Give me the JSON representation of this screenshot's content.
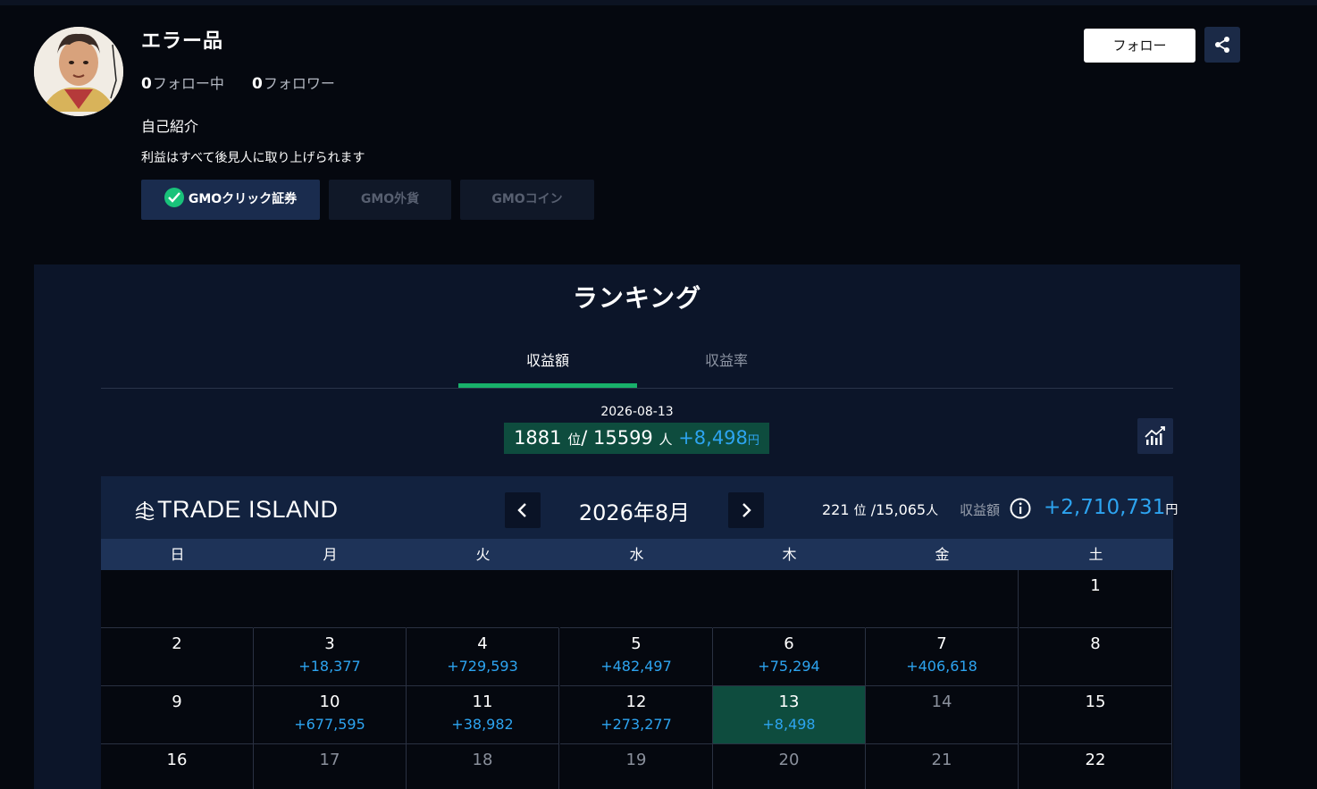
{
  "profile": {
    "name": "エラー品",
    "following_count": "0",
    "following_label": "フォロー中",
    "followers_count": "0",
    "followers_label": "フォロワー",
    "intro_heading": "自己紹介",
    "intro_text": "利益はすべて後見人に取り上げられます",
    "brokers": [
      {
        "label": "GMOクリック証券",
        "active": true
      },
      {
        "label": "GMO外貨",
        "active": false
      },
      {
        "label": "GMOコイン",
        "active": false
      }
    ],
    "follow_button": "フォロー",
    "share_icon": "share-icon"
  },
  "ranking": {
    "title": "ランキング",
    "tabs": [
      {
        "label": "収益額",
        "active": true
      },
      {
        "label": "収益率",
        "active": false
      }
    ],
    "daily": {
      "date": "2026-08-13",
      "rank": "1881",
      "rank_unit": "位",
      "separator": "/",
      "total": "15599",
      "total_unit": "人",
      "profit": "+8,498",
      "profit_unit": "円"
    },
    "chart_icon": "bar-chart-icon"
  },
  "calendar": {
    "brand": "TRADE ISLAND",
    "month": "2026年8月",
    "monthly_rank": "221",
    "monthly_rank_unit": "位",
    "monthly_total": "/15,065",
    "monthly_total_unit": "人",
    "monthly_label": "収益額",
    "monthly_profit": "+2,710,731",
    "monthly_profit_unit": "円",
    "weekdays": [
      "日",
      "月",
      "火",
      "水",
      "木",
      "金",
      "土"
    ],
    "weeks": [
      [
        null,
        null,
        null,
        null,
        null,
        null,
        {
          "day": "1",
          "profit": ""
        }
      ],
      [
        {
          "day": "2",
          "profit": ""
        },
        {
          "day": "3",
          "profit": "+18,377"
        },
        {
          "day": "4",
          "profit": "+729,593"
        },
        {
          "day": "5",
          "profit": "+482,497"
        },
        {
          "day": "6",
          "profit": "+75,294"
        },
        {
          "day": "7",
          "profit": "+406,618"
        },
        {
          "day": "8",
          "profit": ""
        }
      ],
      [
        {
          "day": "9",
          "profit": ""
        },
        {
          "day": "10",
          "profit": "+677,595"
        },
        {
          "day": "11",
          "profit": "+38,982"
        },
        {
          "day": "12",
          "profit": "+273,277"
        },
        {
          "day": "13",
          "profit": "+8,498",
          "today": true
        },
        {
          "day": "14",
          "profit": "",
          "muted": true
        },
        {
          "day": "15",
          "profit": ""
        }
      ],
      [
        {
          "day": "16",
          "profit": ""
        },
        {
          "day": "17",
          "profit": "",
          "muted": true
        },
        {
          "day": "18",
          "profit": "",
          "muted": true
        },
        {
          "day": "19",
          "profit": "",
          "muted": true
        },
        {
          "day": "20",
          "profit": "",
          "muted": true
        },
        {
          "day": "21",
          "profit": "",
          "muted": true
        },
        {
          "day": "22",
          "profit": ""
        }
      ]
    ]
  },
  "colors": {
    "accent_blue": "#2da4f0",
    "highlight_green": "#0e4c3e",
    "tab_green": "#18b06a"
  }
}
